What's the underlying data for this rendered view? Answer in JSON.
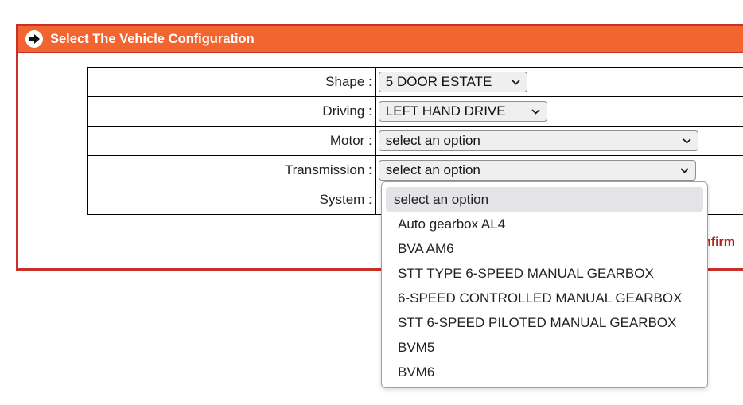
{
  "panel": {
    "title": "Select The Vehicle Configuration",
    "confirm_label_partial": "nfirm",
    "colors": {
      "header_bg": "#f26530",
      "border": "#c8302a",
      "confirm_text": "#b5201a"
    }
  },
  "form": {
    "rows": [
      {
        "label": "Shape :",
        "value": "5 DOOR ESTATE"
      },
      {
        "label": "Driving :",
        "value": "LEFT HAND DRIVE"
      },
      {
        "label": "Motor :",
        "value": "select an option"
      },
      {
        "label": "Transmission :",
        "value": "select an option"
      },
      {
        "label": "System :",
        "value": ""
      }
    ]
  },
  "dropdown": {
    "options": [
      "select an option",
      "Auto gearbox AL4",
      "BVA AM6",
      "STT TYPE 6-SPEED MANUAL GEARBOX",
      "6-SPEED CONTROLLED MANUAL GEARBOX",
      "STT 6-SPEED PILOTED MANUAL GEARBOX",
      "BVM5",
      "BVM6"
    ],
    "selected_index": 0
  },
  "icons": {
    "header": "arrow-right-circle-icon",
    "select": "chevron-down-icon"
  }
}
